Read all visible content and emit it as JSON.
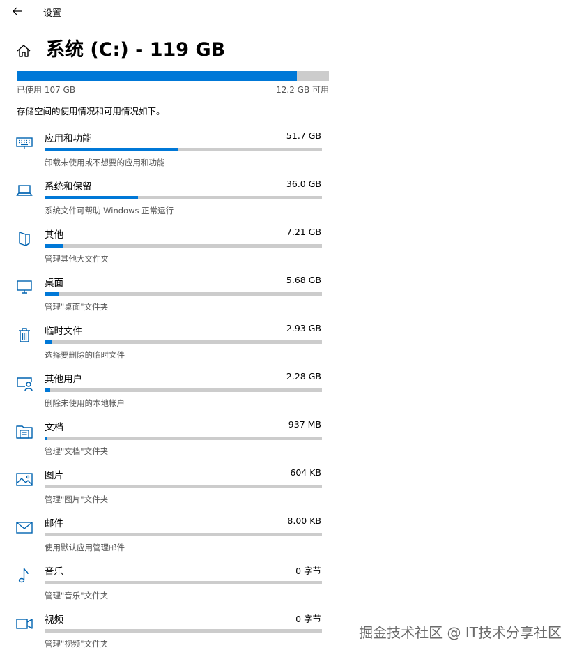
{
  "window": {
    "title": "设置"
  },
  "header": {
    "page_title": "系统 (C:) - 119 GB"
  },
  "drive": {
    "used_label": "已使用 107 GB",
    "free_label": "12.2 GB 可用",
    "used_fraction": 0.897
  },
  "description": "存储空间的使用情况和可用情况如下。",
  "categories": [
    {
      "name": "应用和功能",
      "size": "51.7 GB",
      "subtitle": "卸载未使用或不想要的应用和功能",
      "fraction": 0.483,
      "icon": "keyboard-icon"
    },
    {
      "name": "系统和保留",
      "size": "36.0 GB",
      "subtitle": "系统文件可帮助 Windows 正常运行",
      "fraction": 0.337,
      "icon": "laptop-icon"
    },
    {
      "name": "其他",
      "size": "7.21 GB",
      "subtitle": "管理其他大文件夹",
      "fraction": 0.067,
      "icon": "other-files-icon"
    },
    {
      "name": "桌面",
      "size": "5.68 GB",
      "subtitle": "管理\"桌面\"文件夹",
      "fraction": 0.053,
      "icon": "monitor-icon"
    },
    {
      "name": "临时文件",
      "size": "2.93 GB",
      "subtitle": "选择要删除的临时文件",
      "fraction": 0.027,
      "icon": "trash-icon"
    },
    {
      "name": "其他用户",
      "size": "2.28 GB",
      "subtitle": "删除未使用的本地帐户",
      "fraction": 0.021,
      "icon": "other-users-icon"
    },
    {
      "name": "文档",
      "size": "937 MB",
      "subtitle": "管理\"文档\"文件夹",
      "fraction": 0.008,
      "icon": "documents-icon"
    },
    {
      "name": "图片",
      "size": "604 KB",
      "subtitle": "管理\"图片\"文件夹",
      "fraction": 0.0,
      "icon": "pictures-icon"
    },
    {
      "name": "邮件",
      "size": "8.00 KB",
      "subtitle": "使用默认应用管理邮件",
      "fraction": 0.0,
      "icon": "mail-icon"
    },
    {
      "name": "音乐",
      "size": "0 字节",
      "subtitle": "管理\"音乐\"文件夹",
      "fraction": 0.0,
      "icon": "music-icon"
    },
    {
      "name": "视频",
      "size": "0 字节",
      "subtitle": "管理\"视频\"文件夹",
      "fraction": 0.0,
      "icon": "video-icon"
    }
  ],
  "watermark": "掘金技术社区 @ IT技术分享社区",
  "colors": {
    "accent": "#0078d7",
    "track": "#cccccc",
    "secondary_text": "#555555"
  }
}
